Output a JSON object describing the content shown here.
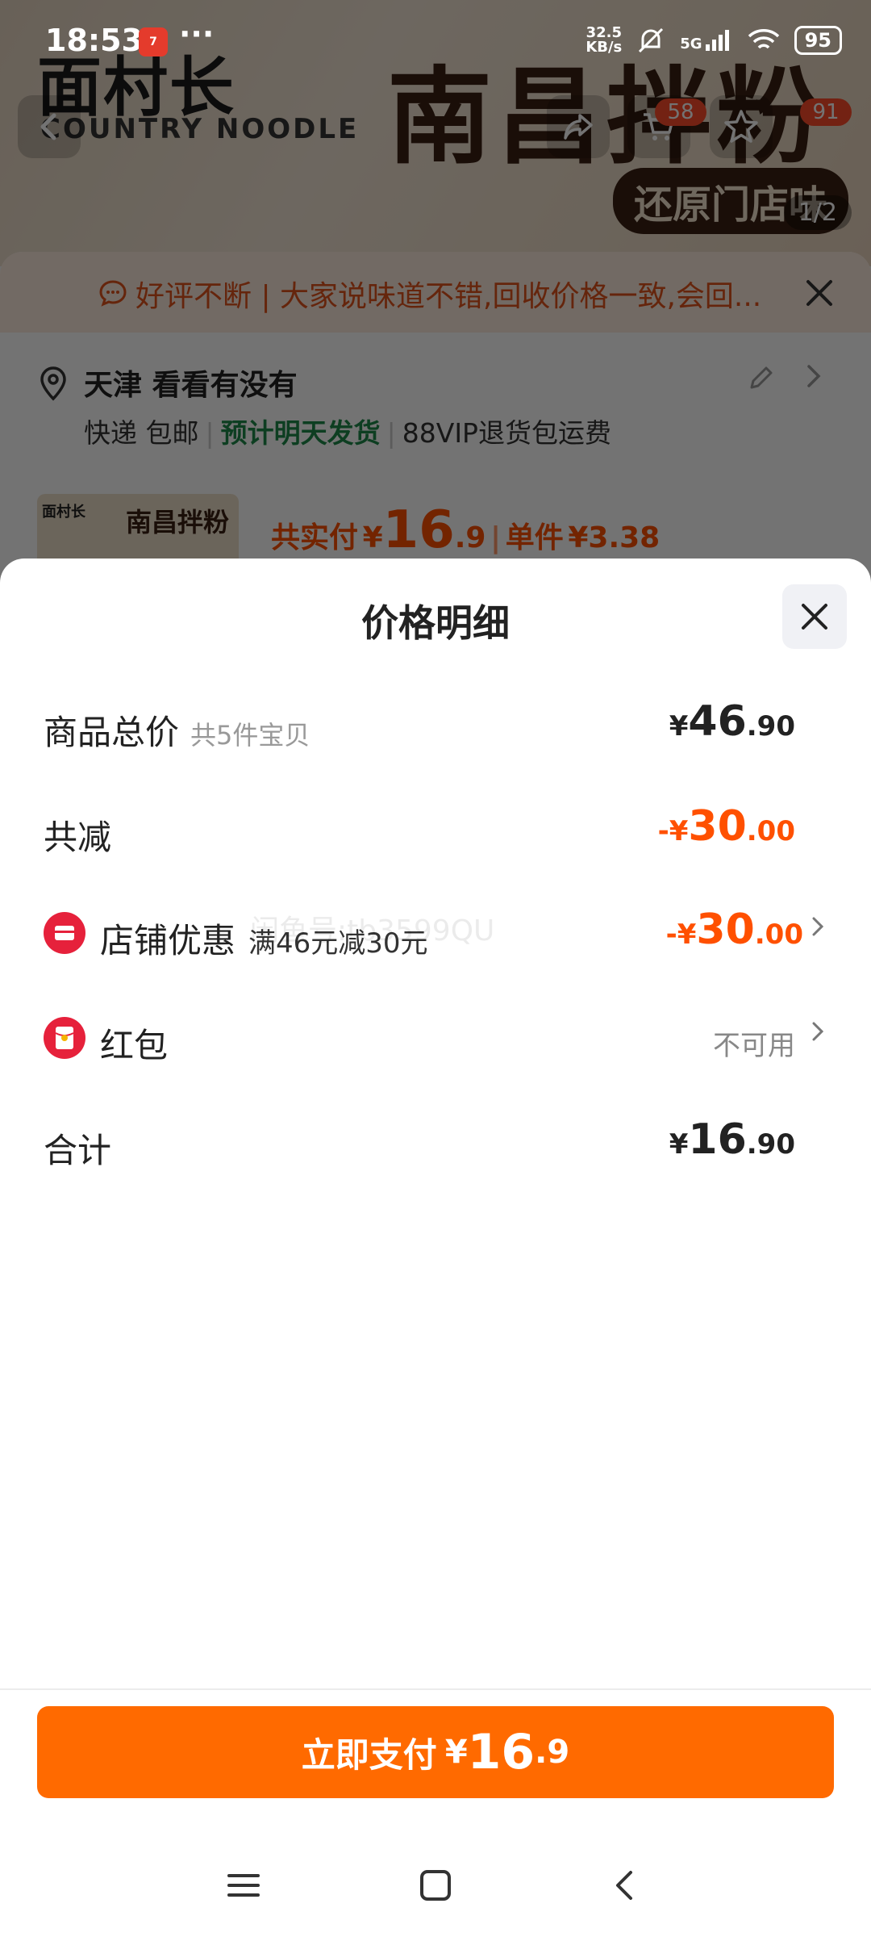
{
  "status_bar": {
    "time": "18:53",
    "dots": "···",
    "net_speed_value": "32.5",
    "net_speed_unit": "KB/s",
    "network": "5G",
    "battery": "95"
  },
  "product_header": {
    "brand": "面村长",
    "brand_sub": "COUNTRY NOODLE",
    "title": "南昌拌粉",
    "tag": "还原门店味",
    "cart_badge": "58",
    "fav_badge": "91",
    "page_indicator": "1/2"
  },
  "notice": {
    "text": "好评不断 | 大家说味道不错,回收价格一致,会回..."
  },
  "address": {
    "city": "天津",
    "detail": "看看有没有",
    "shipping": "快递 包邮",
    "eta": "预计明天发货",
    "vip": "88VIP退货包运费"
  },
  "summary": {
    "label": "共实付",
    "currency": "¥",
    "amount_int": "16",
    "amount_dec": ".9",
    "unit_label": "单件",
    "unit_price": "¥3.38"
  },
  "sheet": {
    "title": "价格明细",
    "rows": {
      "goods_total": {
        "label": "商品总价",
        "note": "共5件宝贝",
        "currency": "¥",
        "int": "46",
        "dec": ".90"
      },
      "total_discount": {
        "label": "共减",
        "currency": "-¥",
        "int": "30",
        "dec": ".00"
      },
      "shop_discount": {
        "label": "店铺优惠",
        "note": "满46元减30元",
        "currency": "-¥",
        "int": "30",
        "dec": ".00"
      },
      "red_packet": {
        "label": "红包",
        "status": "不可用"
      },
      "grand_total": {
        "label": "合计",
        "currency": "¥",
        "int": "16",
        "dec": ".90"
      }
    },
    "watermark": "闲鱼号:tb3599QU"
  },
  "pay_button": {
    "label": "立即支付",
    "currency": "¥",
    "int": "16",
    "dec": ".9"
  },
  "colors": {
    "accent": "#ff6a00",
    "discount": "#ff5000",
    "shop_icon": "#e6213b",
    "eta_green": "#1d8a4a"
  },
  "icons": {
    "back": "back-arrow-icon",
    "share": "share-icon",
    "cart": "cart-icon",
    "favorite": "star-icon",
    "location": "location-pin-icon",
    "edit": "pencil-icon",
    "shop": "shop-icon",
    "red_packet": "red-packet-icon",
    "close": "close-icon"
  }
}
